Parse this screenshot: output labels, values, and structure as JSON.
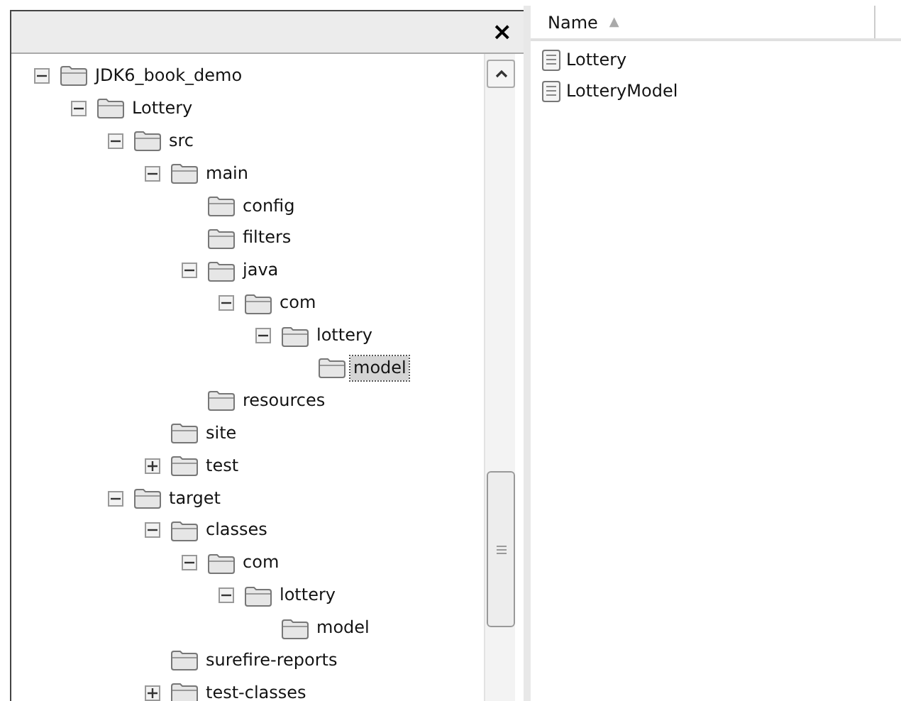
{
  "folders_pane": {
    "close_button": "×",
    "tree": [
      {
        "label": "JDK6_book_demo",
        "expanded": true,
        "selected": false,
        "children": [
          {
            "label": "Lottery",
            "expanded": true,
            "selected": false,
            "children": [
              {
                "label": "src",
                "expanded": true,
                "selected": false,
                "children": [
                  {
                    "label": "main",
                    "expanded": true,
                    "selected": false,
                    "children": [
                      {
                        "label": "config",
                        "selected": false
                      },
                      {
                        "label": "filters",
                        "selected": false
                      },
                      {
                        "label": "java",
                        "expanded": true,
                        "selected": false,
                        "children": [
                          {
                            "label": "com",
                            "expanded": true,
                            "selected": false,
                            "children": [
                              {
                                "label": "lottery",
                                "expanded": true,
                                "selected": false,
                                "children": [
                                  {
                                    "label": "model",
                                    "selected": true
                                  }
                                ]
                              }
                            ]
                          }
                        ]
                      },
                      {
                        "label": "resources",
                        "selected": false
                      }
                    ]
                  },
                  {
                    "label": "site",
                    "selected": false
                  },
                  {
                    "label": "test",
                    "expanded": false,
                    "selected": false
                  }
                ]
              },
              {
                "label": "target",
                "expanded": true,
                "selected": false,
                "children": [
                  {
                    "label": "classes",
                    "expanded": true,
                    "selected": false,
                    "children": [
                      {
                        "label": "com",
                        "expanded": true,
                        "selected": false,
                        "children": [
                          {
                            "label": "lottery",
                            "expanded": true,
                            "selected": false,
                            "children": [
                              {
                                "label": "model",
                                "selected": false
                              }
                            ]
                          }
                        ]
                      }
                    ]
                  },
                  {
                    "label": "surefire-reports",
                    "selected": false
                  },
                  {
                    "label": "test-classes",
                    "expanded": false,
                    "selected": false
                  }
                ]
              }
            ]
          }
        ]
      }
    ]
  },
  "files_pane": {
    "columns": [
      {
        "label": "Name",
        "sort": "▲"
      }
    ],
    "files": [
      {
        "name": "Lottery"
      },
      {
        "name": "LotteryModel"
      }
    ]
  }
}
